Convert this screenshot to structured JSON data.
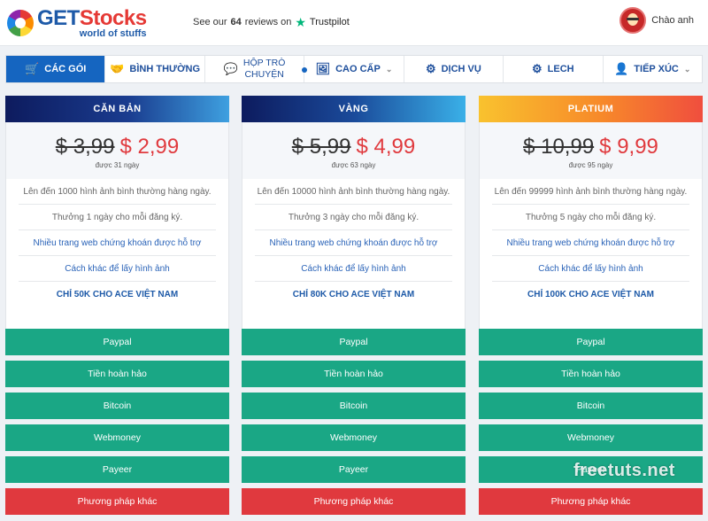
{
  "header": {
    "logo_get": "GET",
    "logo_stocks": "Stocks",
    "logo_tagline": "world of stuffs",
    "reviews_prefix": "See our",
    "reviews_count": "64",
    "reviews_suffix": "reviews on",
    "trustpilot_label": "Trustpilot",
    "user_greeting": "Chào anh"
  },
  "nav": {
    "items": [
      {
        "label": "CÁC GÓI",
        "icon": "cart-icon"
      },
      {
        "label": "BÌNH THƯỜNG",
        "icon": "handshake-icon"
      },
      {
        "label_line1": "HỘP TRÒ",
        "label_line2": "CHUYỆN",
        "icon": "chat-icon"
      },
      {
        "label": "CAO CẤP",
        "icon": "image-icon"
      },
      {
        "label": "DỊCH VỤ",
        "icon": "gear-icon"
      },
      {
        "label": "LECH",
        "icon": "gear-icon"
      },
      {
        "label": "TIẾP XÚC",
        "icon": "person-icon"
      }
    ]
  },
  "plans": [
    {
      "name": "CĂN BẢN",
      "old_price": "$ 3,99",
      "new_price": "$ 2,99",
      "days": "được 31 ngày",
      "features": [
        "Lên đến 1000 hình ảnh bình thường hàng ngày.",
        "Thưởng 1 ngày cho mỗi đăng ký.",
        "Nhiều trang web chứng khoán được hỗ trợ",
        "Cách khác để lấy hình ảnh",
        "CHỈ 50K CHO ACE VIỆT NAM"
      ]
    },
    {
      "name": "VÀNG",
      "old_price": "$ 5,99",
      "new_price": "$ 4,99",
      "days": "được 63 ngày",
      "features": [
        "Lên đến 10000 hình ảnh bình thường hàng ngày.",
        "Thưởng 3 ngày cho mỗi đăng ký.",
        "Nhiều trang web chứng khoán được hỗ trợ",
        "Cách khác để lấy hình ảnh",
        "CHỈ 80K CHO ACE VIỆT NAM"
      ]
    },
    {
      "name": "PLATIUM",
      "old_price": "$ 10,99",
      "new_price": "$ 9,99",
      "days": "được 95 ngày",
      "features": [
        "Lên đến 99999 hình ảnh bình thường hàng ngày.",
        "Thưởng 5 ngày cho mỗi đăng ký.",
        "Nhiều trang web chứng khoán được hỗ trợ",
        "Cách khác để lấy hình ảnh",
        "CHỈ 100K CHO ACE VIỆT NAM"
      ]
    }
  ],
  "payment_methods": [
    "Paypal",
    "Tiền hoàn hảo",
    "Bitcoin",
    "Webmoney",
    "Payeer",
    "Phương pháp khác"
  ],
  "watermark": "freetuts.net",
  "colors": {
    "accent_blue": "#1565c0",
    "pay_green": "#1aa785",
    "pay_red": "#e0393e",
    "price_red": "#e03a3e"
  }
}
